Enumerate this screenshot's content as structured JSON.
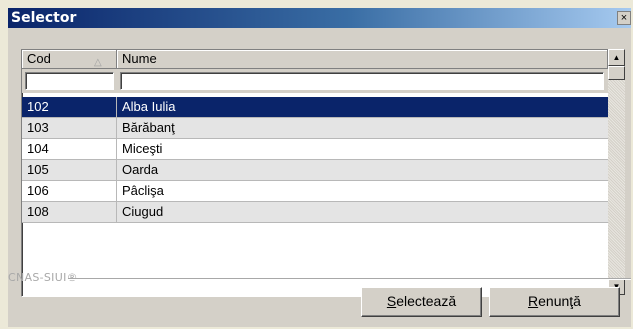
{
  "window": {
    "title": "Selector",
    "close_label": "×"
  },
  "grid": {
    "columns": [
      {
        "label": "Cod"
      },
      {
        "label": "Nume"
      }
    ],
    "sort_icon": "sort-ascending-icon",
    "filters": {
      "cod_value": "",
      "nume_value": ""
    },
    "rows": [
      {
        "cod": "102",
        "nume": "Alba Iulia",
        "selected": true
      },
      {
        "cod": "103",
        "nume": "Bărăbanţ",
        "selected": false
      },
      {
        "cod": "104",
        "nume": "Miceşti",
        "selected": false
      },
      {
        "cod": "105",
        "nume": "Oarda",
        "selected": false
      },
      {
        "cod": "106",
        "nume": "Pâclişa",
        "selected": false
      },
      {
        "cod": "108",
        "nume": "Ciugud",
        "selected": false
      }
    ]
  },
  "footer": {
    "brand": "CNAS-SIUI®",
    "select_button": {
      "accel": "S",
      "rest": "electează"
    },
    "cancel_button": {
      "accel": "R",
      "rest": "enunţă"
    }
  },
  "colors": {
    "selection": "#0a246a",
    "alt_row": "#e4e4e4",
    "title_start": "#0a246a"
  }
}
